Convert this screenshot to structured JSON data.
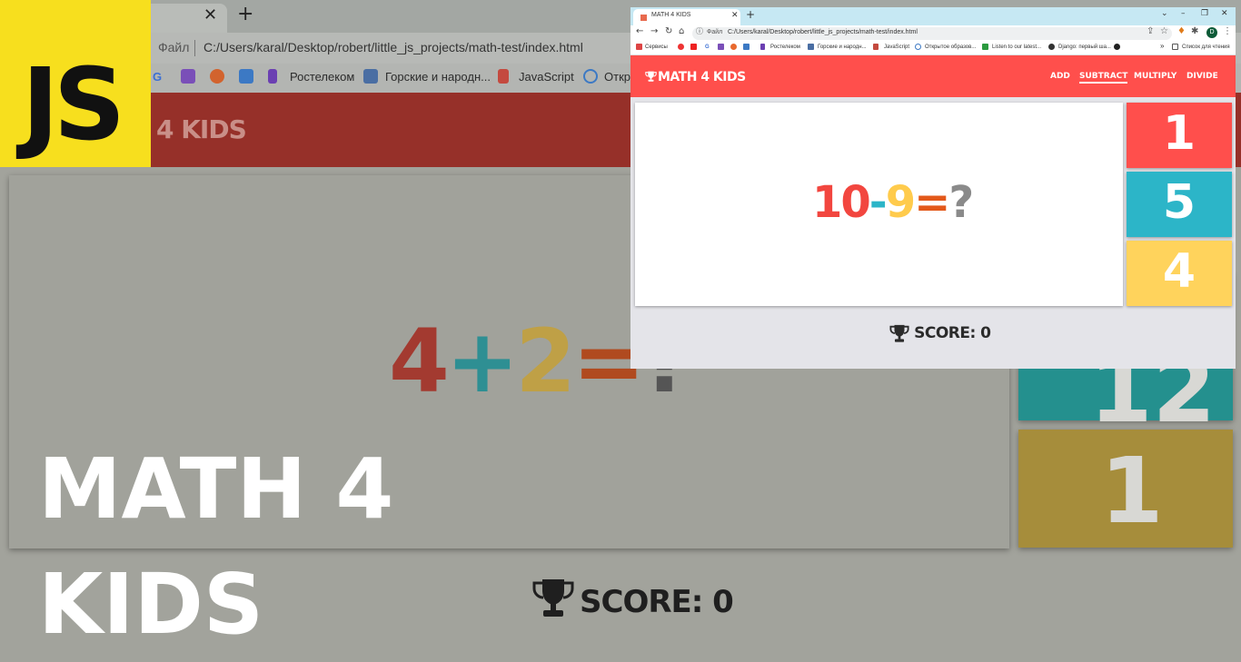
{
  "background_browser": {
    "address_prefix": "Файл",
    "url": "C:/Users/karal/Desktop/robert/little_js_projects/math-test/index.html",
    "bookmarks": [
      "G",
      "Ростелеком",
      "Горские и народн...",
      "JavaScript",
      "Откр"
    ],
    "logo_text": "4 KIDS",
    "equation": {
      "a": "4",
      "op": "+",
      "b": "2",
      "eq": "=",
      "q": "?"
    },
    "choices": [
      "12",
      "1"
    ],
    "score": "SCORE: 0"
  },
  "overlay": {
    "badge": "JS",
    "title_line1": "MATH 4",
    "title_line2": "KIDS"
  },
  "browser": {
    "tab_title": "MATH 4 KIDS",
    "address_prefix": "Файл",
    "url": "C:/Users/karal/Desktop/robert/little_js_projects/math-test/index.html",
    "avatar": "D",
    "bookmarks": [
      "Сервисы",
      "G",
      "Ростелеком",
      "Горские и народн...",
      "JavaScript",
      "Открытое образов...",
      "Listen to our latest...",
      "Django: первый ша...",
      "Список для чтения"
    ]
  },
  "app": {
    "logo": "MATH 4 KIDS",
    "nav": [
      "ADD",
      "SUBTRACT",
      "MULTIPLY",
      "DIVIDE"
    ],
    "active_nav": "SUBTRACT",
    "equation": {
      "a": "10",
      "op": "-",
      "b": "9",
      "eq": "=",
      "q": "?"
    },
    "choices": [
      "1",
      "5",
      "4"
    ],
    "score_label": "SCORE: 0"
  },
  "colors": {
    "navbar": "#ff4f4c",
    "choice_red": "#ff4f4c",
    "choice_teal": "#2cb5c8",
    "choice_yellow": "#ffd35c",
    "num_red": "#f2463f",
    "op_teal": "#2cb5c8",
    "num_yellow": "#ffcb4c",
    "eq_orange": "#e3581a",
    "q_gray": "#8a8a8a",
    "js_yellow": "#f7df1e"
  }
}
